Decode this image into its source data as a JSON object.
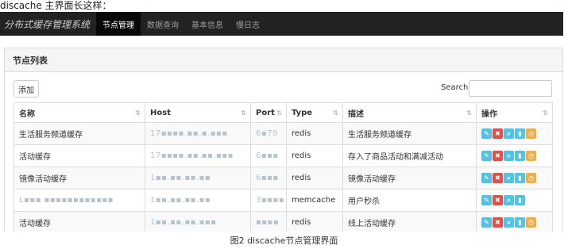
{
  "intro_text": "discache 主界面长这样：",
  "navbar": {
    "brand": "分布式缓存管理系统",
    "items": [
      {
        "label": "节点管理",
        "active": true
      },
      {
        "label": "数据查询",
        "active": false
      },
      {
        "label": "基本信息",
        "active": false
      },
      {
        "label": "慢日志",
        "active": false
      }
    ]
  },
  "panel": {
    "title": "节点列表",
    "add_label": "添加",
    "search_label": "Search:",
    "search_value": ""
  },
  "table": {
    "headers": [
      "名称",
      "Host",
      "Port",
      "Type",
      "描述",
      "操作"
    ],
    "rows": [
      {
        "name": "生活服务频道缓存",
        "host": "17▪▪▪▪.▪▪.▪.▪▪▪",
        "port": "6▪79",
        "type": "redis",
        "desc": "生活服务频道缓存",
        "actions": [
          "edit",
          "delete",
          "search",
          "stats",
          "clock"
        ]
      },
      {
        "name": "活动缓存",
        "host": "17▪▪▪▪.▪▪.▪▪.▪▪▪",
        "port": "6▪▪▪",
        "type": "redis",
        "desc": "存入了商品活动和满减活动",
        "actions": [
          "edit",
          "delete",
          "search",
          "stats",
          "clock"
        ]
      },
      {
        "name": "镜像活动缓存",
        "host": "1▪▪.▪▪.▪▪.▪▪",
        "port": "6▪▪▪",
        "type": "redis",
        "desc": "镜像活动缓存",
        "actions": [
          "edit",
          "delete",
          "search",
          "stats",
          "clock"
        ]
      },
      {
        "name": "L▪▪▪ ▪▪▪▪▪▪▪▪▪▪▪▪",
        "host": "1▪▪.▪▪.▪▪.▪▪",
        "port": "3▪▪▪▪",
        "type": "memcache",
        "desc": "用户秒杀",
        "actions": [
          "edit",
          "delete",
          "search",
          "stats"
        ]
      },
      {
        "name": "活动缓存",
        "host": "1▪▪.▪▪.▪▪.▪▪▪",
        "port": "▪▪▪▪",
        "type": "redis",
        "desc": "线上活动缓存",
        "actions": [
          "edit",
          "delete",
          "search",
          "stats",
          "clock"
        ]
      }
    ]
  },
  "icons": {
    "edit": {
      "glyph": "✎",
      "color": "#5bc0de"
    },
    "delete": {
      "glyph": "✖",
      "color": "#d9534f"
    },
    "search": {
      "glyph": "⌕",
      "color": "#5bc0de"
    },
    "stats": {
      "glyph": "▮",
      "color": "#5bc0de"
    },
    "clock": {
      "glyph": "◷",
      "color": "#f0ad4e"
    }
  },
  "caption": "图2 discache节点管理界面"
}
